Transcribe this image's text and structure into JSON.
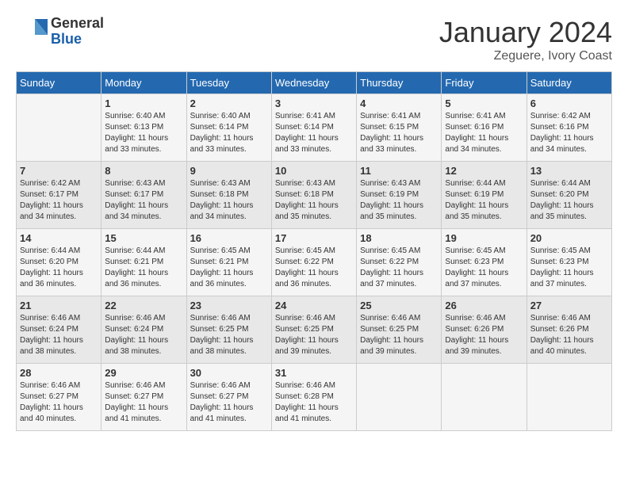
{
  "header": {
    "logo_general": "General",
    "logo_blue": "Blue",
    "month_title": "January 2024",
    "subtitle": "Zeguere, Ivory Coast"
  },
  "calendar": {
    "days_of_week": [
      "Sunday",
      "Monday",
      "Tuesday",
      "Wednesday",
      "Thursday",
      "Friday",
      "Saturday"
    ],
    "weeks": [
      [
        {
          "day": "",
          "content": ""
        },
        {
          "day": "1",
          "content": "Sunrise: 6:40 AM\nSunset: 6:13 PM\nDaylight: 11 hours\nand 33 minutes."
        },
        {
          "day": "2",
          "content": "Sunrise: 6:40 AM\nSunset: 6:14 PM\nDaylight: 11 hours\nand 33 minutes."
        },
        {
          "day": "3",
          "content": "Sunrise: 6:41 AM\nSunset: 6:14 PM\nDaylight: 11 hours\nand 33 minutes."
        },
        {
          "day": "4",
          "content": "Sunrise: 6:41 AM\nSunset: 6:15 PM\nDaylight: 11 hours\nand 33 minutes."
        },
        {
          "day": "5",
          "content": "Sunrise: 6:41 AM\nSunset: 6:16 PM\nDaylight: 11 hours\nand 34 minutes."
        },
        {
          "day": "6",
          "content": "Sunrise: 6:42 AM\nSunset: 6:16 PM\nDaylight: 11 hours\nand 34 minutes."
        }
      ],
      [
        {
          "day": "7",
          "content": "Sunrise: 6:42 AM\nSunset: 6:17 PM\nDaylight: 11 hours\nand 34 minutes."
        },
        {
          "day": "8",
          "content": "Sunrise: 6:43 AM\nSunset: 6:17 PM\nDaylight: 11 hours\nand 34 minutes."
        },
        {
          "day": "9",
          "content": "Sunrise: 6:43 AM\nSunset: 6:18 PM\nDaylight: 11 hours\nand 34 minutes."
        },
        {
          "day": "10",
          "content": "Sunrise: 6:43 AM\nSunset: 6:18 PM\nDaylight: 11 hours\nand 35 minutes."
        },
        {
          "day": "11",
          "content": "Sunrise: 6:43 AM\nSunset: 6:19 PM\nDaylight: 11 hours\nand 35 minutes."
        },
        {
          "day": "12",
          "content": "Sunrise: 6:44 AM\nSunset: 6:19 PM\nDaylight: 11 hours\nand 35 minutes."
        },
        {
          "day": "13",
          "content": "Sunrise: 6:44 AM\nSunset: 6:20 PM\nDaylight: 11 hours\nand 35 minutes."
        }
      ],
      [
        {
          "day": "14",
          "content": "Sunrise: 6:44 AM\nSunset: 6:20 PM\nDaylight: 11 hours\nand 36 minutes."
        },
        {
          "day": "15",
          "content": "Sunrise: 6:44 AM\nSunset: 6:21 PM\nDaylight: 11 hours\nand 36 minutes."
        },
        {
          "day": "16",
          "content": "Sunrise: 6:45 AM\nSunset: 6:21 PM\nDaylight: 11 hours\nand 36 minutes."
        },
        {
          "day": "17",
          "content": "Sunrise: 6:45 AM\nSunset: 6:22 PM\nDaylight: 11 hours\nand 36 minutes."
        },
        {
          "day": "18",
          "content": "Sunrise: 6:45 AM\nSunset: 6:22 PM\nDaylight: 11 hours\nand 37 minutes."
        },
        {
          "day": "19",
          "content": "Sunrise: 6:45 AM\nSunset: 6:23 PM\nDaylight: 11 hours\nand 37 minutes."
        },
        {
          "day": "20",
          "content": "Sunrise: 6:45 AM\nSunset: 6:23 PM\nDaylight: 11 hours\nand 37 minutes."
        }
      ],
      [
        {
          "day": "21",
          "content": "Sunrise: 6:46 AM\nSunset: 6:24 PM\nDaylight: 11 hours\nand 38 minutes."
        },
        {
          "day": "22",
          "content": "Sunrise: 6:46 AM\nSunset: 6:24 PM\nDaylight: 11 hours\nand 38 minutes."
        },
        {
          "day": "23",
          "content": "Sunrise: 6:46 AM\nSunset: 6:25 PM\nDaylight: 11 hours\nand 38 minutes."
        },
        {
          "day": "24",
          "content": "Sunrise: 6:46 AM\nSunset: 6:25 PM\nDaylight: 11 hours\nand 39 minutes."
        },
        {
          "day": "25",
          "content": "Sunrise: 6:46 AM\nSunset: 6:25 PM\nDaylight: 11 hours\nand 39 minutes."
        },
        {
          "day": "26",
          "content": "Sunrise: 6:46 AM\nSunset: 6:26 PM\nDaylight: 11 hours\nand 39 minutes."
        },
        {
          "day": "27",
          "content": "Sunrise: 6:46 AM\nSunset: 6:26 PM\nDaylight: 11 hours\nand 40 minutes."
        }
      ],
      [
        {
          "day": "28",
          "content": "Sunrise: 6:46 AM\nSunset: 6:27 PM\nDaylight: 11 hours\nand 40 minutes."
        },
        {
          "day": "29",
          "content": "Sunrise: 6:46 AM\nSunset: 6:27 PM\nDaylight: 11 hours\nand 41 minutes."
        },
        {
          "day": "30",
          "content": "Sunrise: 6:46 AM\nSunset: 6:27 PM\nDaylight: 11 hours\nand 41 minutes."
        },
        {
          "day": "31",
          "content": "Sunrise: 6:46 AM\nSunset: 6:28 PM\nDaylight: 11 hours\nand 41 minutes."
        },
        {
          "day": "",
          "content": ""
        },
        {
          "day": "",
          "content": ""
        },
        {
          "day": "",
          "content": ""
        }
      ]
    ]
  }
}
